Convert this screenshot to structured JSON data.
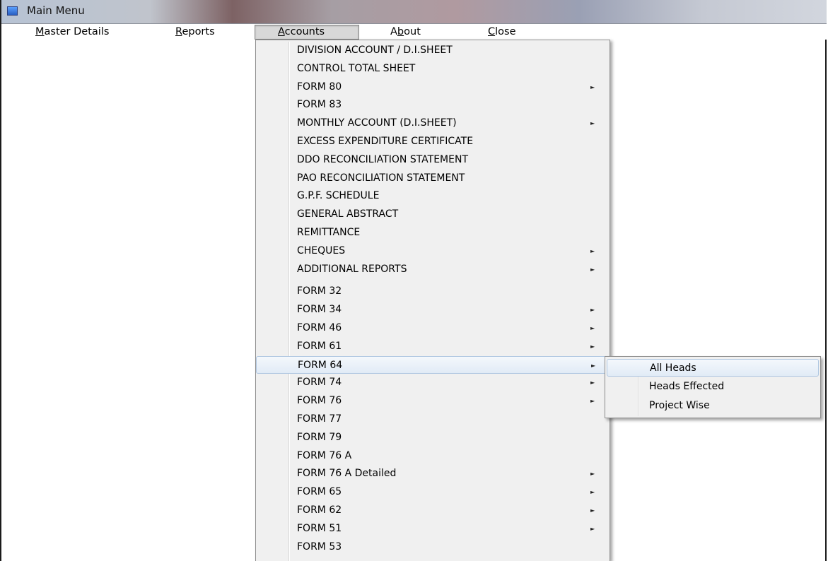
{
  "window": {
    "title": "Main Menu"
  },
  "menubar": {
    "items": [
      {
        "label": "Master Details",
        "mnemonic": "M"
      },
      {
        "label": "Reports",
        "mnemonic": "R"
      },
      {
        "label": "Accounts",
        "mnemonic": "A"
      },
      {
        "label": "About",
        "mnemonic": "b"
      },
      {
        "label": "Close",
        "mnemonic": "C"
      }
    ]
  },
  "accounts_menu": {
    "items": [
      {
        "label": "DIVISION ACCOUNT / D.I.SHEET",
        "has_submenu": false
      },
      {
        "label": "CONTROL TOTAL SHEET",
        "has_submenu": false
      },
      {
        "label": "FORM 80",
        "has_submenu": true
      },
      {
        "label": "FORM 83",
        "has_submenu": false
      },
      {
        "label": "MONTHLY ACCOUNT (D.I.SHEET)",
        "has_submenu": true
      },
      {
        "label": "EXCESS EXPENDITURE CERTIFICATE",
        "has_submenu": false
      },
      {
        "label": "DDO RECONCILIATION STATEMENT",
        "has_submenu": false
      },
      {
        "label": "PAO RECONCILIATION STATEMENT",
        "has_submenu": false
      },
      {
        "label": "G.P.F. SCHEDULE",
        "has_submenu": false
      },
      {
        "label": "GENERAL ABSTRACT",
        "has_submenu": false
      },
      {
        "label": "REMITTANCE",
        "has_submenu": false
      },
      {
        "label": "CHEQUES",
        "has_submenu": true
      },
      {
        "label": "ADDITIONAL REPORTS",
        "has_submenu": true
      },
      {
        "label": "FORM 32",
        "has_submenu": false
      },
      {
        "label": "FORM 34",
        "has_submenu": true
      },
      {
        "label": "FORM 46",
        "has_submenu": true
      },
      {
        "label": "FORM 61",
        "has_submenu": true
      },
      {
        "label": "FORM 64",
        "has_submenu": true,
        "highlighted": true
      },
      {
        "label": "FORM 74",
        "has_submenu": true
      },
      {
        "label": "FORM 76",
        "has_submenu": true
      },
      {
        "label": "FORM 77",
        "has_submenu": false
      },
      {
        "label": "FORM 79",
        "has_submenu": false
      },
      {
        "label": "FORM 76 A",
        "has_submenu": false
      },
      {
        "label": "FORM 76 A Detailed",
        "has_submenu": true
      },
      {
        "label": "FORM 65",
        "has_submenu": true
      },
      {
        "label": "FORM 62",
        "has_submenu": true
      },
      {
        "label": "FORM 51",
        "has_submenu": true
      },
      {
        "label": "FORM 53",
        "has_submenu": false
      }
    ]
  },
  "form64_submenu": {
    "items": [
      {
        "label": "All Heads",
        "highlighted": true
      },
      {
        "label": "Heads Effected"
      },
      {
        "label": "Project Wise"
      }
    ]
  },
  "icons": {
    "submenu_arrow": "►",
    "app": "app-icon"
  },
  "colors": {
    "highlight_border": "#b0c7e1",
    "menu_bg": "#f0f0f0"
  }
}
